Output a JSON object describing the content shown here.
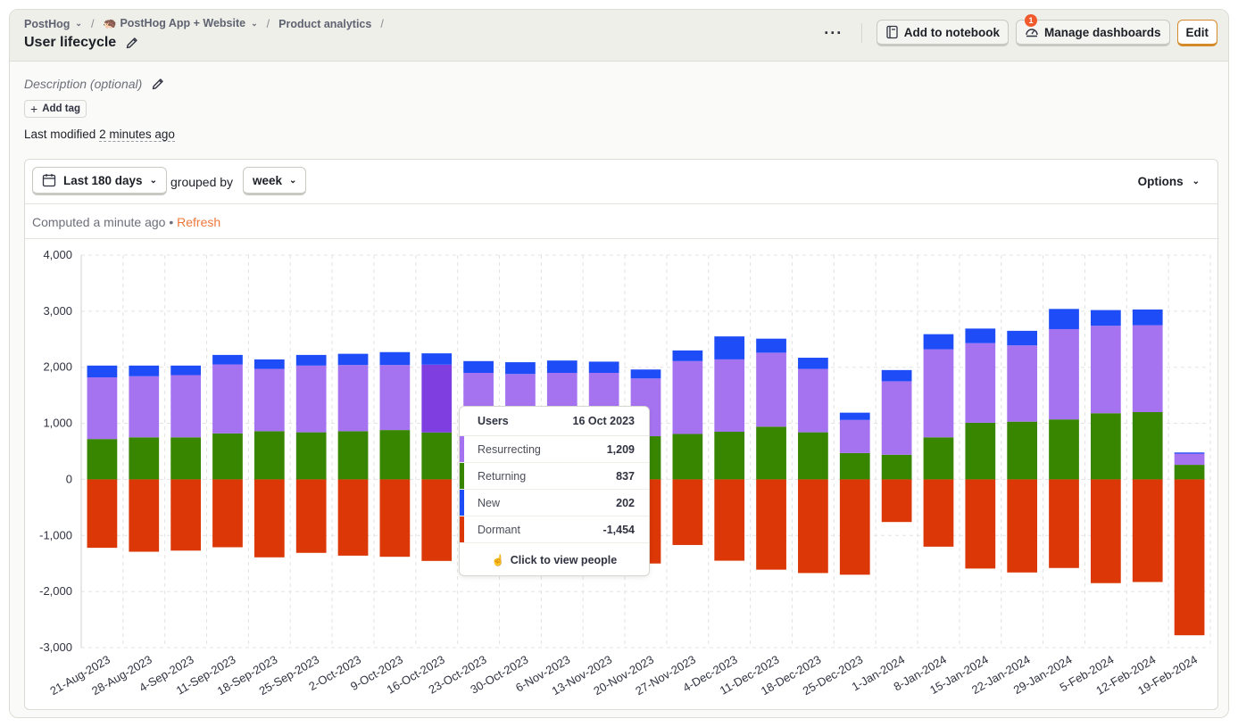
{
  "breadcrumbs": [
    {
      "label": "PostHog",
      "dropdown": true
    },
    {
      "label": "🦔 PostHog App + Website",
      "dropdown": true
    },
    {
      "label": "Product analytics",
      "dropdown": false
    }
  ],
  "page_title": "User lifecycle",
  "actions": {
    "more": "···",
    "add_to_notebook": "Add to notebook",
    "manage_dashboards": "Manage dashboards",
    "manage_dashboards_badge": "1",
    "edit": "Edit"
  },
  "description_placeholder": "Description (optional)",
  "add_tag": "Add tag",
  "last_modified": {
    "prefix": "Last modified",
    "ago": "2 minutes ago"
  },
  "controls": {
    "date_range": "Last 180 days",
    "grouped_by_label": "grouped by",
    "interval": "week",
    "options": "Options"
  },
  "computed": {
    "text": "Computed a minute ago",
    "dot": "•",
    "refresh": "Refresh"
  },
  "tooltip": {
    "header_label": "Users",
    "header_date": "16 Oct 2023",
    "rows": [
      {
        "label": "Resurrecting",
        "value": "1,209",
        "color": "#a673f0"
      },
      {
        "label": "Returning",
        "value": "837",
        "color": "#388600"
      },
      {
        "label": "New",
        "value": "202",
        "color": "#1e4cf7"
      },
      {
        "label": "Dormant",
        "value": "-1,454",
        "color": "#db3707"
      }
    ],
    "footer": "Click to view people"
  },
  "colors": {
    "new": "#1e4cf7",
    "returning": "#388600",
    "resurrecting": "#a673f0",
    "dormant": "#db3707",
    "highlight": "#7f3fe0",
    "accent": "#f0773b"
  },
  "chart_data": {
    "type": "bar",
    "stacked": true,
    "ylim": [
      -3000,
      4000
    ],
    "yticks": [
      "4,000",
      "3,000",
      "2,000",
      "1,000",
      "0",
      "-1,000",
      "-2,000",
      "-3,000"
    ],
    "ytick_values": [
      4000,
      3000,
      2000,
      1000,
      0,
      -1000,
      -2000,
      -3000
    ],
    "grid": true,
    "highlighted_index": 8,
    "categories": [
      "21-Aug-2023",
      "28-Aug-2023",
      "4-Sep-2023",
      "11-Sep-2023",
      "18-Sep-2023",
      "25-Sep-2023",
      "2-Oct-2023",
      "9-Oct-2023",
      "16-Oct-2023",
      "23-Oct-2023",
      "30-Oct-2023",
      "6-Nov-2023",
      "13-Nov-2023",
      "20-Nov-2023",
      "27-Nov-2023",
      "4-Dec-2023",
      "11-Dec-2023",
      "18-Dec-2023",
      "25-Dec-2023",
      "1-Jan-2024",
      "8-Jan-2024",
      "15-Jan-2024",
      "22-Jan-2024",
      "29-Jan-2024",
      "5-Feb-2024",
      "12-Feb-2024",
      "19-Feb-2024"
    ],
    "series": [
      {
        "key": "returning",
        "values": [
          720,
          750,
          750,
          820,
          860,
          840,
          860,
          880,
          837,
          880,
          870,
          870,
          900,
          770,
          810,
          850,
          940,
          840,
          470,
          440,
          750,
          1010,
          1030,
          1070,
          1180,
          1200,
          260
        ]
      },
      {
        "key": "resurrecting",
        "values": [
          1100,
          1090,
          1110,
          1230,
          1110,
          1190,
          1180,
          1160,
          1209,
          1020,
          1010,
          1030,
          1000,
          1030,
          1300,
          1290,
          1320,
          1130,
          590,
          1310,
          1570,
          1420,
          1360,
          1610,
          1560,
          1550,
          200
        ]
      },
      {
        "key": "new",
        "values": [
          210,
          190,
          170,
          170,
          170,
          190,
          200,
          230,
          202,
          210,
          210,
          220,
          200,
          160,
          190,
          410,
          250,
          200,
          130,
          200,
          270,
          260,
          260,
          360,
          280,
          280,
          20
        ]
      },
      {
        "key": "dormant",
        "values": [
          -1220,
          -1290,
          -1270,
          -1210,
          -1390,
          -1310,
          -1360,
          -1380,
          -1454,
          -1370,
          -1410,
          -1360,
          -1430,
          -1500,
          -1170,
          -1450,
          -1610,
          -1670,
          -1700,
          -760,
          -1200,
          -1590,
          -1660,
          -1580,
          -1850,
          -1830,
          -2780
        ]
      }
    ]
  }
}
